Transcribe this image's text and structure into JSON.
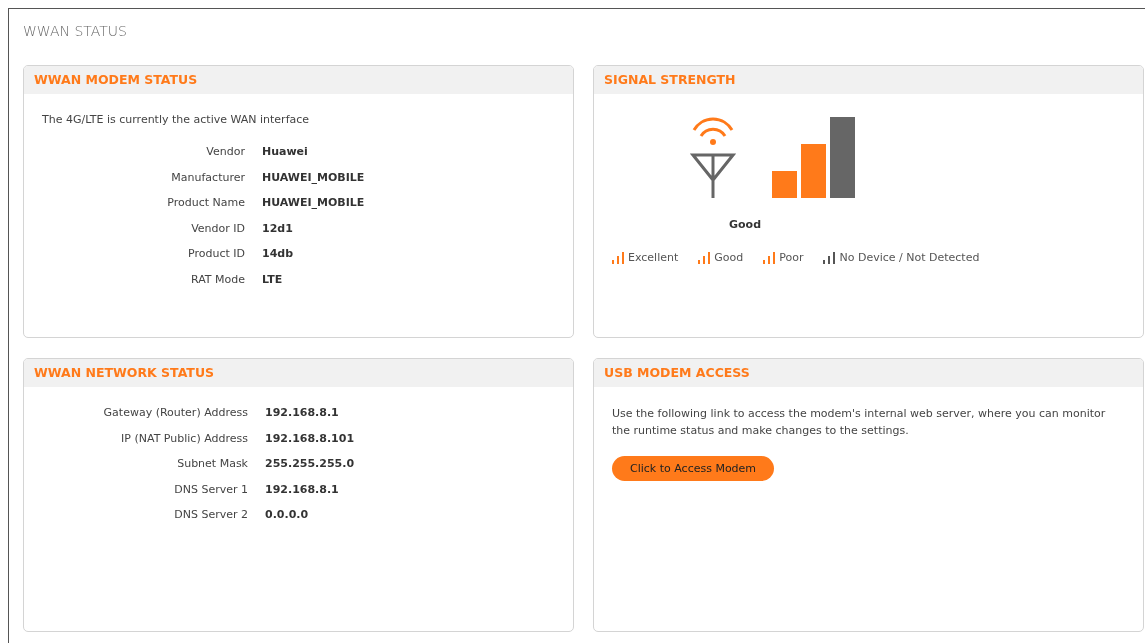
{
  "page_title": "WWAN STATUS",
  "modem_status": {
    "title": "WWAN MODEM STATUS",
    "note": "The 4G/LTE is currently the active WAN interface",
    "fields": [
      {
        "label": "Vendor",
        "value": "Huawei"
      },
      {
        "label": "Manufacturer",
        "value": "HUAWEI_MOBILE"
      },
      {
        "label": "Product Name",
        "value": "HUAWEI_MOBILE"
      },
      {
        "label": "Vendor ID",
        "value": "12d1"
      },
      {
        "label": "Product ID",
        "value": "14db"
      },
      {
        "label": "RAT Mode",
        "value": "LTE"
      }
    ]
  },
  "signal_strength": {
    "title": "SIGNAL STRENGTH",
    "bars": [
      {
        "on": true
      },
      {
        "on": true
      },
      {
        "on": false
      }
    ],
    "quality_label": "Good",
    "legend": [
      {
        "label": "Excellent",
        "color": "#ff7a1a"
      },
      {
        "label": "Good",
        "color": "#ff7a1a"
      },
      {
        "label": "Poor",
        "color": "#ff7a1a"
      },
      {
        "label": "No Device / Not Detected",
        "color": "#555555"
      }
    ]
  },
  "network_status": {
    "title": "WWAN NETWORK STATUS",
    "fields": [
      {
        "label": "Gateway (Router) Address",
        "value": "192.168.8.1"
      },
      {
        "label": "IP (NAT Public) Address",
        "value": "192.168.8.101"
      },
      {
        "label": "Subnet Mask",
        "value": "255.255.255.0"
      },
      {
        "label": "DNS Server 1",
        "value": "192.168.8.1"
      },
      {
        "label": "DNS Server 2",
        "value": "0.0.0.0"
      }
    ]
  },
  "usb_modem_access": {
    "title": "USB MODEM ACCESS",
    "description": "Use the following link to access the modem's internal web server, where you can monitor the runtime status and make changes to the settings.",
    "button": "Click to Access Modem"
  }
}
